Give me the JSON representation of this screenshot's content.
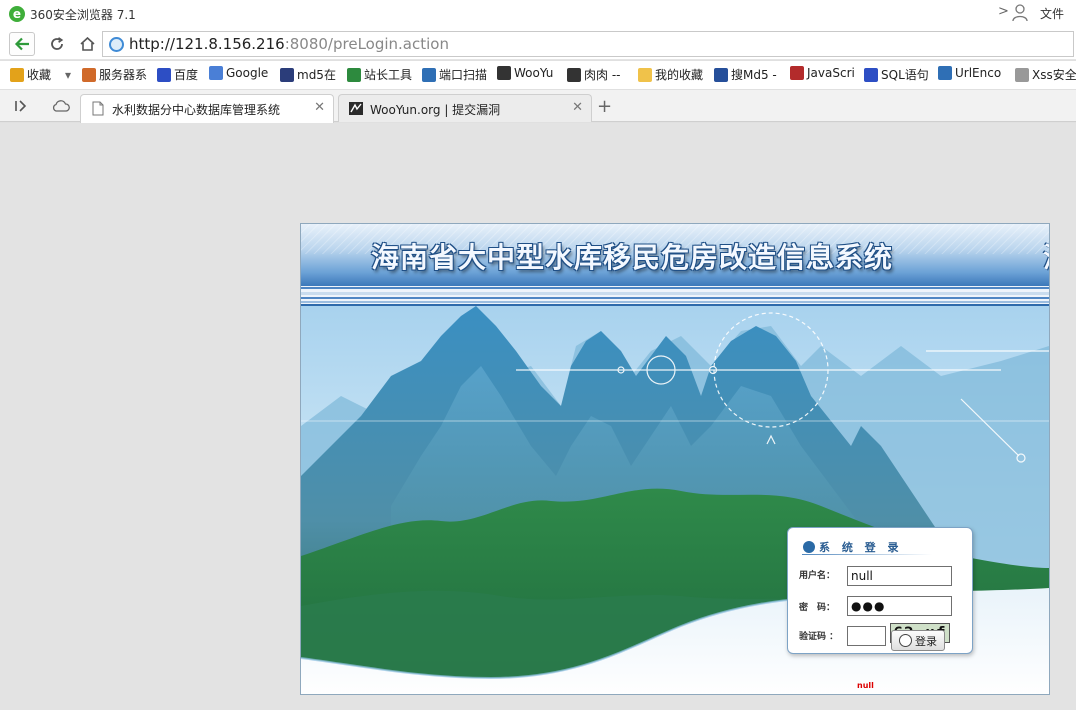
{
  "browser": {
    "title": "360安全浏览器 7.1",
    "file_menu": "文件",
    "url_host": "http://121.8.156.216",
    "url_rest": ":8080/preLogin.action"
  },
  "bookmarks": [
    {
      "label": "收藏",
      "icon": "star-icon",
      "color": "#e3a21a"
    },
    {
      "label": "服务器系",
      "icon": "tools-icon",
      "color": "#d06a2a"
    },
    {
      "label": "百度",
      "icon": "paw-icon",
      "color": "#2d4ec4"
    },
    {
      "label": "Google",
      "icon": "google-icon",
      "color": "#4a7fd6"
    },
    {
      "label": "md5在",
      "icon": "grid-icon",
      "color": "#2b3d7a"
    },
    {
      "label": "站长工具",
      "icon": "webmaster-icon",
      "color": "#2d8a3e"
    },
    {
      "label": "端口扫描",
      "icon": "port-icon",
      "color": "#2f6fb5"
    },
    {
      "label": "WooYu",
      "icon": "wooyun-icon",
      "color": "#333333"
    },
    {
      "label": "肉肉 --",
      "icon": "wooyun-icon",
      "color": "#333333"
    },
    {
      "label": "我的收藏",
      "icon": "folder-icon",
      "color": "#f0c24a"
    },
    {
      "label": "搜Md5 -",
      "icon": "md5-icon",
      "color": "#264f9a"
    },
    {
      "label": "JavaScri",
      "icon": "w3-icon",
      "color": "#b32b2b"
    },
    {
      "label": "SQL语句",
      "icon": "paw-icon",
      "color": "#2d4ec4"
    },
    {
      "label": "UrlEnco",
      "icon": "port-icon",
      "color": "#2f6fb5"
    },
    {
      "label": "Xss安全",
      "icon": "page-icon",
      "color": "#999999"
    }
  ],
  "tabs": [
    {
      "label": "水利数据分中心数据库管理系统",
      "icon": "page-icon"
    },
    {
      "label": "WooYun.org | 提交漏洞",
      "icon": "wooyun-icon"
    }
  ],
  "page": {
    "banner_title": "海南省大中型水库移民危房改造信息系统",
    "banner_edge_char": "海",
    "login": {
      "heading": "系 统 登 录",
      "username_label": "用户名：",
      "username_value": "null",
      "password_label": "密　码：",
      "password_mask": "●●●",
      "captcha_label": "验证码 ：",
      "captcha_text": "62 uf",
      "submit_label": "登录",
      "message": "null"
    }
  },
  "colors": {
    "banner_blue": "#3c78ba",
    "accent": "#2a6aa6",
    "error": "#dd0000"
  }
}
